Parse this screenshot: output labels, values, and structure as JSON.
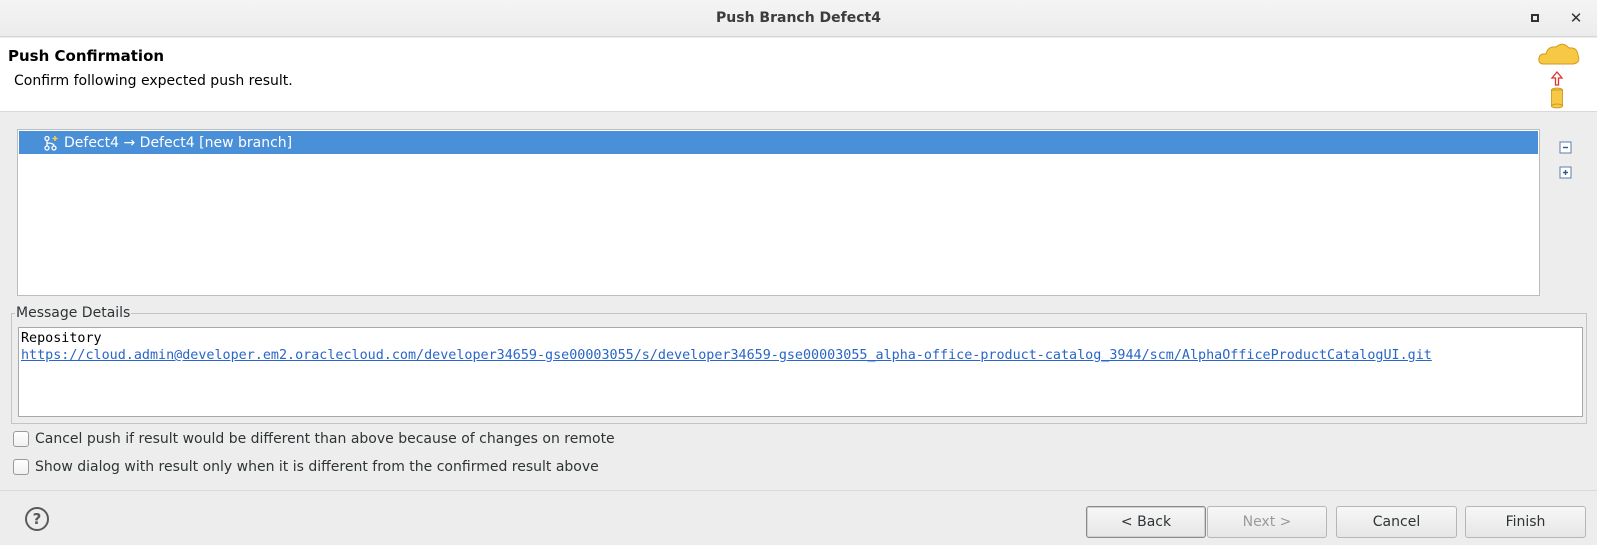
{
  "window": {
    "title": "Push Branch Defect4",
    "maximize_icon": "maximize-icon",
    "close_label": "✕"
  },
  "header": {
    "title": "Push Confirmation",
    "description": "Confirm following expected push result.",
    "icon": "push-to-cloud-icon"
  },
  "results_tree": {
    "rows": [
      {
        "label": "Defect4 → Defect4 [new branch]",
        "icon": "new-branch-icon",
        "selected": true
      }
    ],
    "collapse_icon": "collapse-all-icon",
    "expand_icon": "expand-all-icon"
  },
  "message_details": {
    "label": "Message Details",
    "line1": "Repository",
    "url": "https://cloud.admin@developer.em2.oraclecloud.com/developer34659-gse00003055/s/developer34659-gse00003055_alpha-office-product-catalog_3944/scm/AlphaOfficeProductCatalogUI.git"
  },
  "options": {
    "cancel_if_different": {
      "label": "Cancel push if result would be different than above because of changes on remote",
      "checked": false
    },
    "show_only_if_different": {
      "label": "Show dialog with result only when it is different from the confirmed result above",
      "checked": false
    }
  },
  "footer": {
    "help_label": "?",
    "back_label": "< Back",
    "next_label": "Next >",
    "cancel_label": "Cancel",
    "finish_label": "Finish",
    "next_enabled": false
  },
  "colors": {
    "selection": "#4a90d9",
    "link": "#2a65c8"
  }
}
